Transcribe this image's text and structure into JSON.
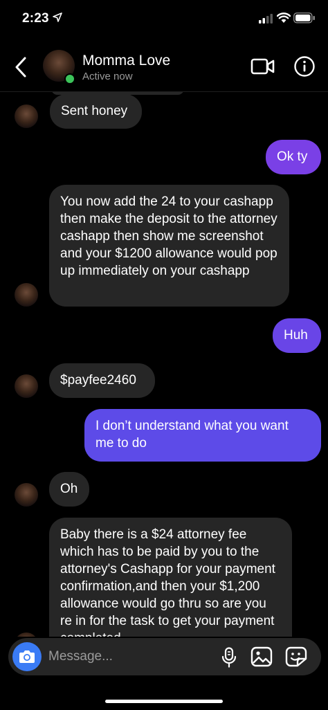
{
  "status_bar": {
    "time": "2:23"
  },
  "header": {
    "contact_name": "Momma Love",
    "contact_status": "Active now"
  },
  "colors": {
    "outgoing_top": "#7b3fe6",
    "outgoing_bottom": "#5b4be8",
    "incoming": "#262626",
    "online": "#3cc35a",
    "camera": "#3a7bf5"
  },
  "messages": [
    {
      "from": "contact",
      "text": "Sent honey"
    },
    {
      "from": "me",
      "text": "Ok ty"
    },
    {
      "from": "contact",
      "text": "You now add the 24 to your cashapp then make the deposit to the attorney cashapp then show me screenshot and your $1200 allowance would pop up immediately on your cashapp"
    },
    {
      "from": "me",
      "text": "Huh"
    },
    {
      "from": "contact",
      "text": "$payfee2460"
    },
    {
      "from": "me",
      "text": "I don’t understand what you want me to do"
    },
    {
      "from": "contact",
      "text": "Oh"
    },
    {
      "from": "contact",
      "text": "Baby there is a $24 attorney fee which has to be paid by you to the attorney's Cashapp for your payment confirmation,and then your $1,200 allowance would go thru so are you re in for the task to get your payment completed"
    }
  ],
  "composer": {
    "placeholder": "Message..."
  },
  "icons": {
    "back": "chevron-left-icon",
    "video": "video-camera-icon",
    "info": "info-icon",
    "camera": "camera-icon",
    "mic": "microphone-icon",
    "gallery": "photo-gallery-icon",
    "sticker": "sticker-icon"
  }
}
